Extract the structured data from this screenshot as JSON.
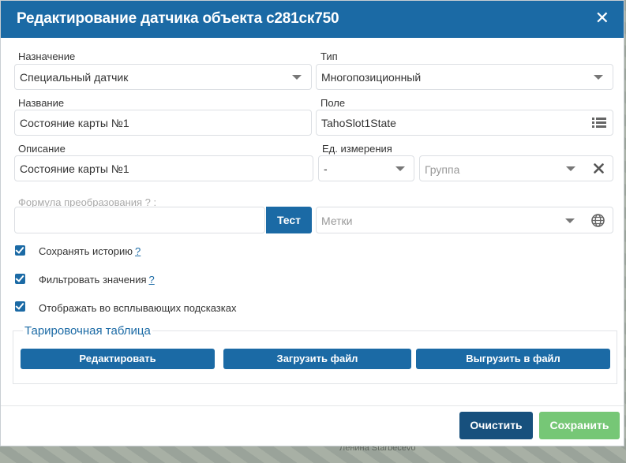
{
  "dialog": {
    "title": "Редактирование датчика объекта с281ск750",
    "close_glyph": "✕"
  },
  "form": {
    "purpose": {
      "label": "Назначение",
      "value": "Специальный датчик"
    },
    "type": {
      "label": "Тип",
      "value": "Многопозиционный"
    },
    "name": {
      "label": "Название",
      "value": "Состояние карты №1"
    },
    "field": {
      "label": "Поле",
      "value": "TahoSlot1State"
    },
    "description": {
      "label": "Описание",
      "value": "Состояние карты №1"
    },
    "unit": {
      "label": "Ед. измерения",
      "value": "-"
    },
    "group": {
      "placeholder": "Группа"
    },
    "formula": {
      "label": "Формула преобразования ? :",
      "value": "",
      "test_label": "Тест"
    },
    "tags": {
      "placeholder": "Метки"
    }
  },
  "checkboxes": [
    {
      "label": "Сохранять историю",
      "help": "?",
      "checked": true
    },
    {
      "label": "Фильтровать значения",
      "help": "?",
      "checked": true
    },
    {
      "label": "Отображать во всплывающих подсказках",
      "help": "",
      "checked": true
    }
  ],
  "calibration": {
    "legend": "Тарировочная таблица",
    "edit_label": "Редактировать",
    "load_label": "Загрузить файл",
    "export_label": "Выгрузить в файл"
  },
  "footer": {
    "clear_label": "Очистить",
    "save_label": "Сохранить"
  },
  "icons": {
    "list": "list-icon",
    "clear": "clear-x-icon",
    "globe": "globe-icon",
    "dropdown": "chevron-down-icon"
  },
  "colors": {
    "primary": "#1b6aa5",
    "dark_button": "#17507d",
    "save_button": "#76c776"
  }
}
